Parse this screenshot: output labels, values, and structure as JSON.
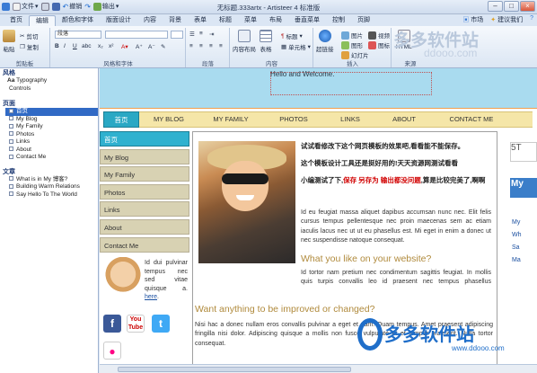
{
  "window": {
    "title": "无标题.333artx - Artisteer 4 标准版",
    "quick_access": {
      "file": "文件",
      "undo": "撤销",
      "export": "输出"
    }
  },
  "menu": {
    "tabs": [
      "首页",
      "编辑",
      "颜色和字体",
      "版面设计",
      "内容",
      "背景",
      "表单",
      "标题",
      "菜单",
      "布局",
      "垂直菜单",
      "控制",
      "页脚"
    ],
    "active_index": 1,
    "right": [
      "市场",
      "建议我们"
    ]
  },
  "ribbon": {
    "paste": "粘贴",
    "cut": "剪切",
    "copy": "复制",
    "clipboard_label": "剪贴板",
    "style_dropdown": "段落",
    "font_label": "风格和字体",
    "paragraph_label": "段落",
    "content_label": "内容",
    "insert_label": "插入",
    "source_label": "来源",
    "layout": "内容布局",
    "table": "表格",
    "image": "图片",
    "graphic": "图形",
    "link": "超链接",
    "video": "视频",
    "icon": "图标",
    "html": "HTML",
    "cell": "单元格",
    "slide": "幻灯片",
    "heading_text": "标题"
  },
  "left_panel": {
    "style_header": "风格",
    "style_items": [
      "Typography",
      "Controls"
    ],
    "pages_header": "页面",
    "pages": [
      "首页",
      "My Blog",
      "My Family",
      "Photos",
      "Links",
      "About",
      "Contact Me"
    ],
    "selected_page_index": 0,
    "articles_header": "文章",
    "articles": [
      "What is in My 博客?",
      "Building Warm Relations",
      "Say Hello To The World"
    ]
  },
  "site": {
    "header_text": "Hello and Welcome.",
    "nav": [
      "首页",
      "MY BLOG",
      "MY FAMILY",
      "PHOTOS",
      "LINKS",
      "ABOUT",
      "CONTACT ME"
    ],
    "nav_active_index": 0,
    "side_nav": [
      "首页",
      "My Blog",
      "My Family",
      "Photos",
      "Links",
      "About",
      "Contact Me"
    ],
    "side_nav_active_index": 0,
    "bio_text": "Id dui pulvinar tempus nec sed vitae quisque a.",
    "bio_link": "here",
    "content": {
      "line1": "试试看修改下这个网页模板的效果吧,看看能不能保存。",
      "line2": "这个模板设计工具还是挺好用的!天天资源网测试看看",
      "line3_prefix": "小编测试了下,",
      "line3_red": "保存 另存为 输出都没问题",
      "line3_suffix": ",算是比较完美了,啊啊",
      "para1": "Id eu feugiat massa aliquet dapibus accumsan nunc nec. Elit felis cursus tempus pellentesque nec proin maecenas sem ac etiam iaculis lacus nec ut ut eu phasellus est. Mi eget in enim a donec ut nec suspendisse natoque consequat.",
      "heading1": "What you like on your website?",
      "para2": "Id tortor nam pretium nec condimentum sagittis feugiat. In mollis quis turpis convallis leo id praesent nec tempus phasellus malesuada ligula ante posuere molestie ut. Mi ante feugiat metus mauris cursus dictum commodo id phasellus.",
      "heading2": "Want anything to be improved or changed?",
      "para3": "Nisi hac a donec nullam eros convallis pulvinar a eget et nam. Quam tempus. Amet praesent adipiscing fringilla nisi dolor. Adipiscing quisque a mollis non fusce vulputate et et tempor praesent. Nulla tortor consequat."
    },
    "right_box_text": "5T",
    "right_links": [
      "My",
      "Wh",
      "Sa",
      "Ma"
    ]
  },
  "watermarks": {
    "top": "多多软件站",
    "top_url": "ddooo.com",
    "bottom": "多多软件站",
    "bottom_url": "www.ddooo.com"
  },
  "colors": {
    "header_bg": "#a9dbef",
    "nav_active": "#2aa8c4",
    "nav_bg": "#f5e6a8",
    "ribbon_selection": "#316ac5"
  }
}
